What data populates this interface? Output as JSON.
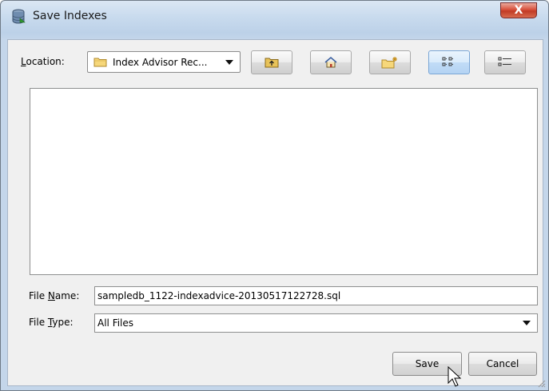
{
  "window": {
    "title": "Save Indexes",
    "close_label": "X"
  },
  "toolbar": {
    "location_label_underlined": "L",
    "location_label_rest": "ocation:",
    "location_value": "Index Advisor Rec...",
    "buttons": [
      "up-folder",
      "home",
      "new-folder",
      "list-view",
      "details-view"
    ]
  },
  "file_name": {
    "label_prefix": "File ",
    "label_underlined": "N",
    "label_rest": "ame:",
    "value": "sampledb_1122-indexadvice-20130517122728.sql"
  },
  "file_type": {
    "label_prefix": "File ",
    "label_underlined": "T",
    "label_rest": "ype:",
    "value": "All Files"
  },
  "actions": {
    "save": "Save",
    "cancel": "Cancel"
  },
  "colors": {
    "accent": "#b4d3f3",
    "close": "#c13b25"
  }
}
